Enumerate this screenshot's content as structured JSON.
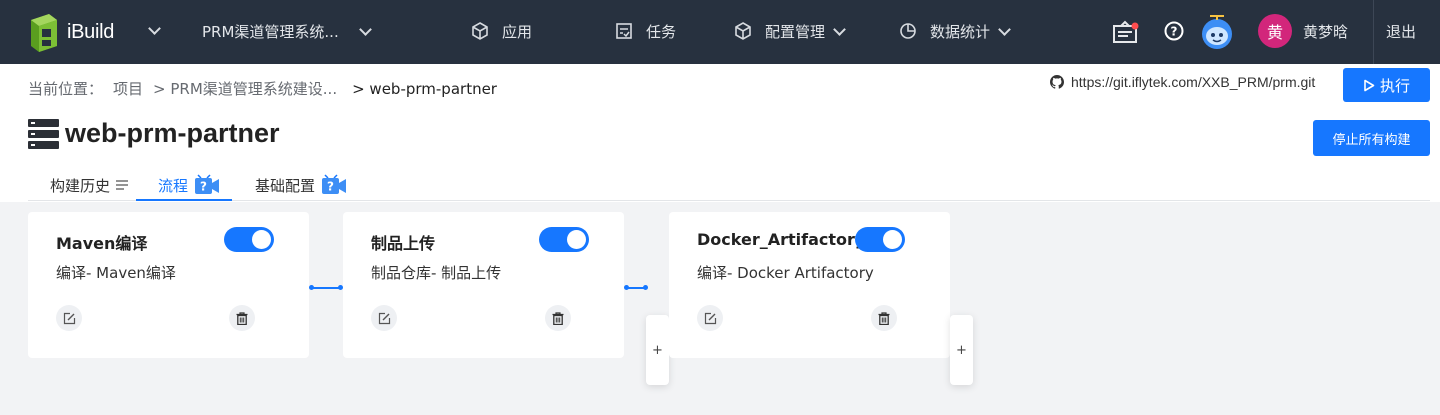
{
  "nav": {
    "brand": "iBuild",
    "project": "PRM渠道管理系统...",
    "items": [
      {
        "label": "应用",
        "icon": "cube-icon"
      },
      {
        "label": "任务",
        "icon": "task-icon"
      },
      {
        "label": "配置管理",
        "icon": "box-icon"
      },
      {
        "label": "数据统计",
        "icon": "pie-chart-icon"
      }
    ],
    "avatar_char": "黄",
    "user_name": "黄梦晗",
    "logout": "退出"
  },
  "breadcrumb": {
    "prefix": "当前位置：",
    "items": [
      "项目",
      "> PRM渠道管理系统建设...",
      "> web-prm-partner"
    ]
  },
  "repo": {
    "url": "https://git.iflytek.com/XXB_PRM/prm.git",
    "run_label": "执行"
  },
  "page": {
    "title": "web-prm-partner",
    "stop_all_label": "停止所有构建"
  },
  "tabs": [
    {
      "label": "构建历史"
    },
    {
      "label": "流程"
    },
    {
      "label": "基础配置"
    }
  ],
  "flow": {
    "cards": [
      {
        "name": "Maven编译",
        "desc": "编译- Maven编译",
        "enabled": true
      },
      {
        "name": "制品上传",
        "desc": "制品仓库- 制品上传",
        "enabled": true
      },
      {
        "name": "Docker_Artifactory",
        "desc": "编译- Docker Artifactory",
        "enabled": true
      }
    ],
    "plus": "+"
  },
  "colors": {
    "nav_bg": "#27313f",
    "primary": "#1677ff",
    "avatar": "#d2267b",
    "logo_green": "#8bc34a"
  }
}
